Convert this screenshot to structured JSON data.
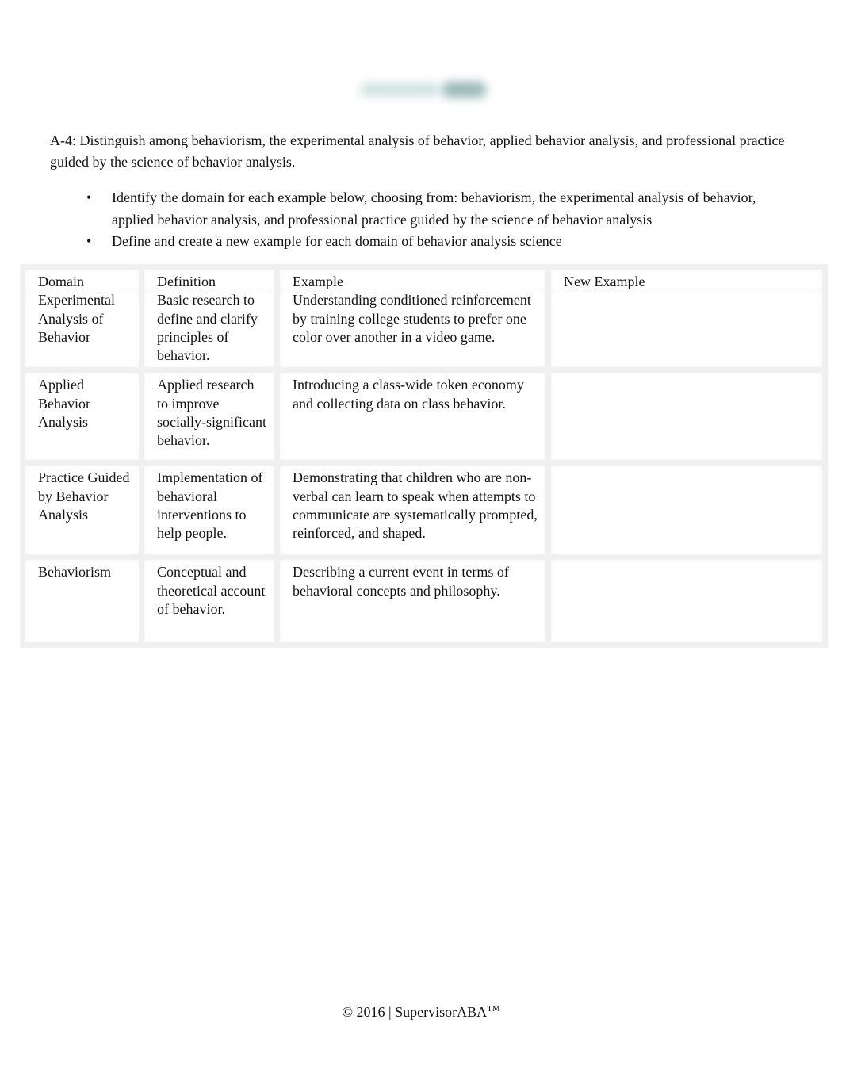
{
  "logo": {
    "alt": "SupervisorABA logo (blurred)"
  },
  "intro": "A-4: Distinguish among behaviorism, the experimental analysis of behavior, applied behavior analysis, and professional practice guided by the science of behavior analysis.",
  "bullets": [
    {
      "symbol": "•",
      "text": "Identify the domain for each example below, choosing from:   behaviorism, the experimental analysis of behavior, applied behavior analysis, and professional practice guided by the science of behavior analysis"
    },
    {
      "symbol": "•",
      "text": "Define and create a new example for each domain of behavior analysis science"
    }
  ],
  "table": {
    "headers": [
      "Domain",
      "Definition",
      "Example",
      "New Example"
    ],
    "rows": [
      {
        "domain": "Experimental Analysis of Behavior",
        "definition": "Basic research to define and clarify principles of behavior.",
        "example": "Understanding conditioned reinforcement by training college students to prefer one color over another in a video game.",
        "new_example": ""
      },
      {
        "domain": "Applied Behavior Analysis",
        "definition": "Applied research to improve socially-significant behavior.",
        "example": "Introducing a class-wide token economy and collecting data on class behavior.",
        "new_example": ""
      },
      {
        "domain": "Practice Guided by Behavior Analysis",
        "definition": "Implementation of behavioral interventions to help people.",
        "example": "Demonstrating that children who are non-verbal can learn to speak when attempts to communicate are systematically prompted, reinforced, and shaped.",
        "new_example": ""
      },
      {
        "domain": "Behaviorism",
        "definition": "Conceptual and theoretical account of behavior.",
        "example": "Describing a current event in terms of behavioral concepts and philosophy.",
        "new_example": ""
      }
    ]
  },
  "footer": {
    "text": "© 2016 | SupervisorABA",
    "trademark": "TM"
  }
}
